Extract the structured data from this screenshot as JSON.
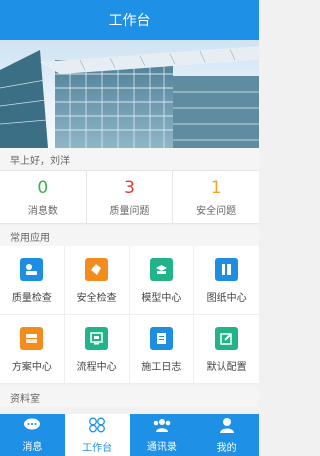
{
  "header": {
    "title": "工作台"
  },
  "greeting": "早上好，刘洋",
  "stats": [
    {
      "value": "0",
      "label": "消息数",
      "color": "#3cb34a"
    },
    {
      "value": "3",
      "label": "质量问题",
      "color": "#e03c32"
    },
    {
      "value": "1",
      "label": "安全问题",
      "color": "#f0a81e"
    }
  ],
  "sections": {
    "apps_title": "常用应用",
    "library_title": "资料室"
  },
  "apps": [
    {
      "label": "质量检查",
      "icon": "quality-check-icon",
      "color": "#1e8fe0"
    },
    {
      "label": "安全检查",
      "icon": "safety-check-icon",
      "color": "#f38b1d"
    },
    {
      "label": "模型中心",
      "icon": "model-center-icon",
      "color": "#22b38a"
    },
    {
      "label": "图纸中心",
      "icon": "drawing-center-icon",
      "color": "#1e8fe0"
    },
    {
      "label": "方案中心",
      "icon": "plan-center-icon",
      "color": "#f38b1d"
    },
    {
      "label": "流程中心",
      "icon": "process-center-icon",
      "color": "#22b38a"
    },
    {
      "label": "施工日志",
      "icon": "construction-log-icon",
      "color": "#1e8fe0"
    },
    {
      "label": "默认配置",
      "icon": "default-config-icon",
      "color": "#22b38a"
    }
  ],
  "tabs": [
    {
      "label": "消息",
      "icon": "chat-icon",
      "active": false
    },
    {
      "label": "工作台",
      "icon": "workbench-icon",
      "active": true
    },
    {
      "label": "通讯录",
      "icon": "contacts-icon",
      "active": false
    },
    {
      "label": "我的",
      "icon": "user-icon",
      "active": false
    }
  ]
}
